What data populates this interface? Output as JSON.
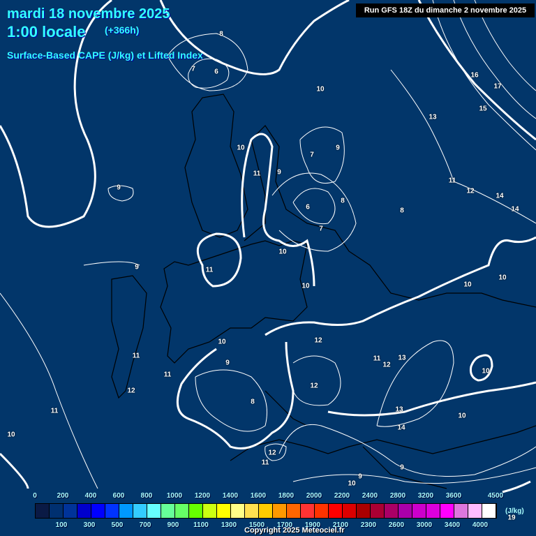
{
  "header": {
    "date": "mardi 18 novembre 2025",
    "time": "1:00 locale",
    "lead": "(+366h)",
    "product": "Surface-Based CAPE (J/kg) et Lifted Index",
    "run": "Run GFS 18Z du dimanche 2 novembre 2025"
  },
  "contour_labels": [
    "8",
    "7",
    "6",
    "10",
    "16",
    "17",
    "15",
    "13",
    "10",
    "9",
    "7",
    "11",
    "9",
    "9",
    "11",
    "12",
    "14",
    "14",
    "6",
    "8",
    "8",
    "7",
    "10",
    "11",
    "9",
    "10",
    "10",
    "10",
    "10",
    "12",
    "11",
    "13",
    "12",
    "11",
    "9",
    "11",
    "10",
    "12",
    "12",
    "8",
    "11",
    "13",
    "14",
    "10",
    "10",
    "12",
    "11",
    "9",
    "9",
    "10",
    "19"
  ],
  "legend": {
    "colors": [
      "#0a1a45",
      "#003070",
      "#003399",
      "#0000cc",
      "#0000ff",
      "#0033ff",
      "#0099ff",
      "#33ccff",
      "#66ffff",
      "#66ff99",
      "#66ff66",
      "#66ff00",
      "#ccff11",
      "#ffff00",
      "#ffff88",
      "#ffe050",
      "#ffcc00",
      "#ff9900",
      "#ff6600",
      "#ff3333",
      "#ff3300",
      "#ff0000",
      "#dd0000",
      "#aa0000",
      "#aa0033",
      "#aa0066",
      "#aa00aa",
      "#cc00cc",
      "#dd00dd",
      "#ff00ff",
      "#dd77dd",
      "#ffbbff",
      "#ffffff"
    ],
    "top_labels": [
      "0",
      "200",
      "400",
      "600",
      "800",
      "1000",
      "1200",
      "1400",
      "1600",
      "1800",
      "2000",
      "2200",
      "2400",
      "2800",
      "3200",
      "3600",
      "4500"
    ],
    "bottom_labels": [
      "100",
      "300",
      "500",
      "700",
      "900",
      "1100",
      "1300",
      "1500",
      "1700",
      "1900",
      "2100",
      "2300",
      "2600",
      "3000",
      "3400",
      "4000"
    ],
    "unit": "(J/kg)"
  },
  "copyright": "Copyright 2025 Meteociel.fr"
}
